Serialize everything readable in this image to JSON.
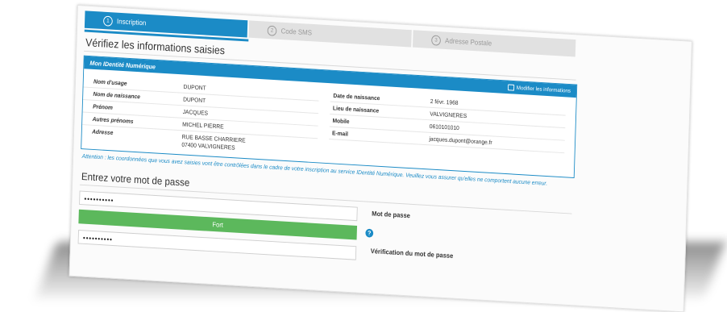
{
  "steps": [
    {
      "num": "1",
      "label": "Inscription",
      "active": true
    },
    {
      "num": "2",
      "label": "Code SMS",
      "active": false
    },
    {
      "num": "3",
      "label": "Adresse Postale",
      "active": false
    }
  ],
  "verify": {
    "title": "Vérifiez les informations saisies",
    "panel_title": "Mon IDentité Numérique",
    "modify_label": "Modifier les informations"
  },
  "identity_left": [
    {
      "label": "Nom d'usage",
      "value": "DUPONT"
    },
    {
      "label": "Nom de naissance",
      "value": "DUPONT"
    },
    {
      "label": "Prénom",
      "value": "JACQUES"
    },
    {
      "label": "Autres prénoms",
      "value": "MICHEL PIERRE"
    },
    {
      "label": "Adresse",
      "value_line1": "RUE BASSE CHARRIERE",
      "value_line2": "07400 VALVIGNERES"
    }
  ],
  "identity_right": [
    {
      "label": "Date de naissance",
      "value": "2 févr. 1968"
    },
    {
      "label": "Lieu de naissance",
      "value": "VALVIGNERES"
    },
    {
      "label": "Mobile",
      "value": "0610101010"
    },
    {
      "label": "E-mail",
      "value": "jacques.dupont@orange.fr"
    }
  ],
  "notice": "Attention : les coordonnées que vous avez saisies vont être contrôlées dans le cadre de votre inscription au service IDentité Numérique. Veuillez vous assurer qu'elles ne comportent aucune erreur.",
  "password": {
    "title": "Entrez votre mot de passe",
    "value": "••••••••••",
    "strength_label": "Fort",
    "strength_color": "#5cb85c",
    "field_label": "Mot de passe",
    "confirm_value": "••••••••••",
    "confirm_label": "Vérification du mot de passe",
    "help_glyph": "?"
  },
  "colors": {
    "accent": "#1b8bc6",
    "success": "#5cb85c"
  }
}
